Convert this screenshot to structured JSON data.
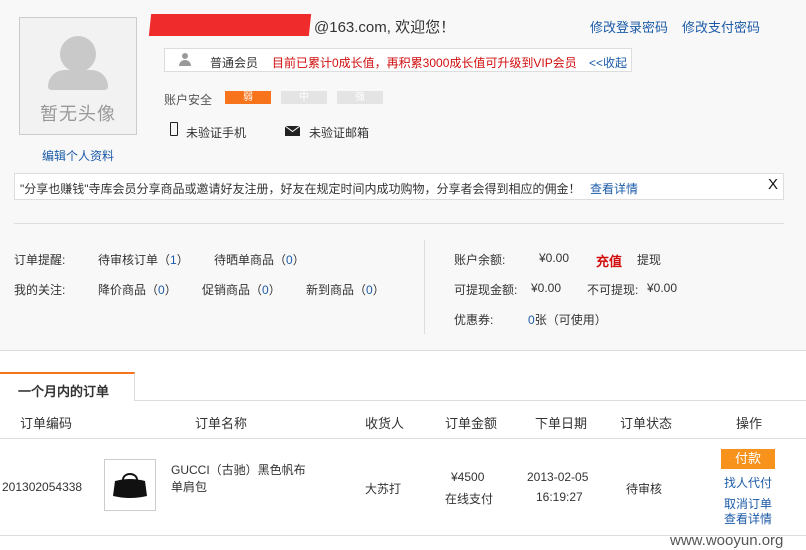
{
  "profile": {
    "avatar_text": "暂无头像",
    "edit_profile": "编辑个人资料",
    "welcome": "@163.com, 欢迎您！",
    "change_login_pwd": "修改登录密码",
    "change_pay_pwd": "修改支付密码",
    "member_level": "普通会员",
    "member_note": "目前已累计0成长值，再积累3000成长值可升级到VIP会员",
    "collapse": "<<收起",
    "security_label": "账户安全",
    "security_levels": [
      "弱",
      "中",
      "强"
    ],
    "phone": "未验证手机",
    "email": "未验证邮箱"
  },
  "share": {
    "text": "\"分享也赚钱\"寺库会员分享商品或邀请好友注册，好友在规定时间内成功购物，分享者会得到相应的佣金！",
    "detail": "查看详情",
    "close": "X"
  },
  "reminders": {
    "order_label": "订单提醒:",
    "pending_orders": "待审核订单（",
    "pending_count": "1",
    "pending_close": "）",
    "review_goods": "待晒单商品（",
    "review_count": "0",
    "review_close": "）",
    "follow_label": "我的关注:",
    "price_drop": "降价商品（",
    "price_drop_count": "0",
    "price_drop_close": "）",
    "promo": "促销商品（",
    "promo_count": "0",
    "promo_close": "）",
    "new_arrival": "新到商品（",
    "new_arrival_count": "0",
    "new_arrival_close": "）"
  },
  "account": {
    "balance_label": "账户余额:",
    "balance": "¥0.00",
    "recharge": "充值",
    "withdraw": "提现",
    "withdrawable_label": "可提现金额:",
    "withdrawable": "¥0.00",
    "non_withdrawable_label": "不可提现:",
    "non_withdrawable": "¥0.00",
    "coupon_label": "优惠券:",
    "coupon_count": "0",
    "coupon_suffix": "张（可使用）"
  },
  "orders": {
    "tab": "一个月内的订单",
    "columns": [
      "订单编码",
      "订单名称",
      "收货人",
      "订单金额",
      "下单日期",
      "订单状态",
      "操作"
    ],
    "rows": [
      {
        "order_id": "201302054338",
        "name_line1": "GUCCI（古驰）黑色帆布",
        "name_line2": "单肩包",
        "receiver": "大苏打",
        "amount": "¥4500",
        "pay_method": "在线支付",
        "date": "2013-02-05",
        "time": "16:19:27",
        "status": "待审核",
        "actions": {
          "pay": "付款",
          "proxy": "找人代付",
          "cancel": "取消订单",
          "detail": "查看详情"
        }
      }
    ]
  },
  "watermark": "www.wooyun.org",
  "colors": {
    "accent": "#f7731c",
    "link": "#1c5ba8",
    "alert": "#d10d0d",
    "pay_button": "#f7931c"
  }
}
